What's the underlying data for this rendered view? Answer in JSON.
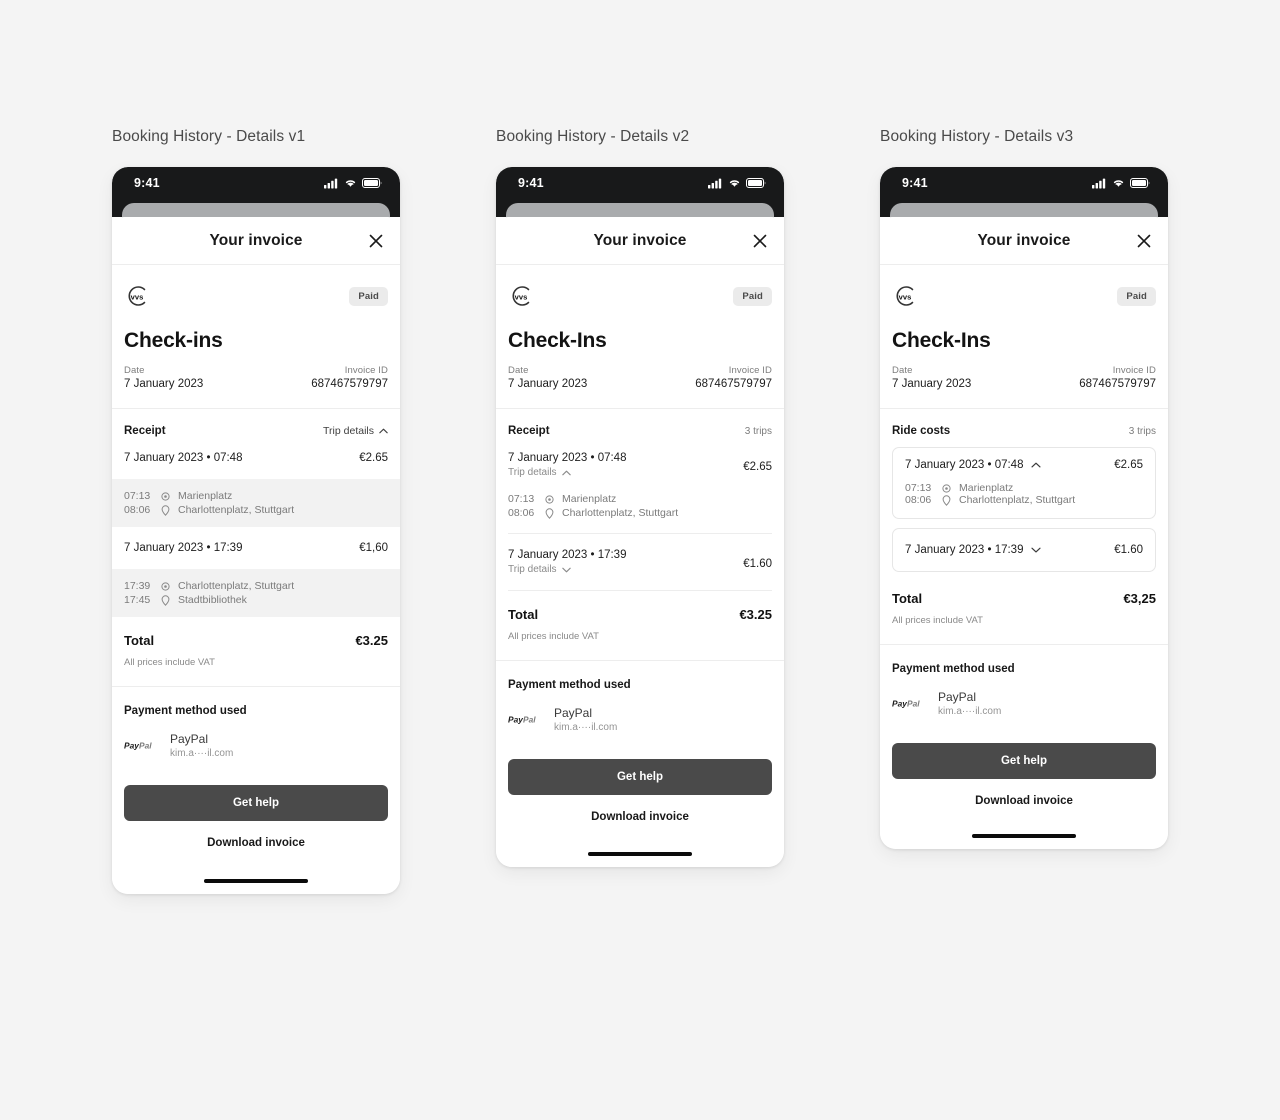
{
  "background": "#f4f4f4",
  "accent_button": "#4a4a4a",
  "screens": [
    {
      "caption": "Booking History - Details v1",
      "status": {
        "time": "9:41"
      },
      "header": {
        "title": "Your invoice",
        "close_icon": "close-icon"
      },
      "brand": {
        "logo_text": "vvs",
        "badge": "Paid"
      },
      "invoice": {
        "title": "Check-ins",
        "date_label": "Date",
        "date_value": "7 January 2023",
        "invoice_id_label": "Invoice ID",
        "invoice_id_value": "687467579797"
      },
      "receipt": {
        "heading": "Receipt",
        "right_label": "Trip details",
        "right_icon": "chevron-up-icon",
        "trips": [
          {
            "date": "7 January 2023 • 07:48",
            "amount": "€2.65",
            "legs": [
              {
                "time": "07:13",
                "icon": "circle-dot-icon",
                "place": "Marienplatz"
              },
              {
                "time": "08:06",
                "icon": "map-pin-icon",
                "place": "Charlottenplatz, Stuttgart"
              }
            ]
          },
          {
            "date": "7 January 2023 • 17:39",
            "amount": "€1,60",
            "legs": [
              {
                "time": "17:39",
                "icon": "circle-dot-icon",
                "place": "Charlottenplatz, Stuttgart"
              },
              {
                "time": "17:45",
                "icon": "map-pin-icon",
                "place": "Stadtbibliothek"
              }
            ]
          }
        ],
        "total_label": "Total",
        "total_value": "€3.25",
        "vat_note": "All prices include VAT"
      },
      "payment": {
        "heading": "Payment method used",
        "provider_logo": "paypal-logo",
        "provider": "PayPal",
        "account": "kim.a····il.com"
      },
      "actions": {
        "primary": "Get help",
        "secondary": "Download invoice"
      }
    },
    {
      "caption": "Booking History - Details v2",
      "status": {
        "time": "9:41"
      },
      "header": {
        "title": "Your invoice",
        "close_icon": "close-icon"
      },
      "brand": {
        "logo_text": "vvs",
        "badge": "Paid"
      },
      "invoice": {
        "title": "Check-Ins",
        "date_label": "Date",
        "date_value": "7 January 2023",
        "invoice_id_label": "Invoice ID",
        "invoice_id_value": "687467579797"
      },
      "receipt": {
        "heading": "Receipt",
        "right_label": "3 trips",
        "trips": [
          {
            "date": "7 January 2023 • 07:48",
            "sub_label": "Trip details",
            "sub_icon": "chevron-up-icon",
            "expanded": true,
            "amount": "€2.65",
            "legs": [
              {
                "time": "07:13",
                "icon": "circle-dot-icon",
                "place": "Marienplatz"
              },
              {
                "time": "08:06",
                "icon": "map-pin-icon",
                "place": "Charlottenplatz, Stuttgart"
              }
            ]
          },
          {
            "date": "7 January 2023 • 17:39",
            "sub_label": "Trip details",
            "sub_icon": "chevron-down-icon",
            "expanded": false,
            "amount": "€1.60",
            "legs": []
          }
        ],
        "total_label": "Total",
        "total_value": "€3.25",
        "vat_note": "All prices include VAT"
      },
      "payment": {
        "heading": "Payment method used",
        "provider_logo": "paypal-logo",
        "provider": "PayPal",
        "account": "kim.a····il.com"
      },
      "actions": {
        "primary": "Get help",
        "secondary": "Download invoice"
      }
    },
    {
      "caption": "Booking History - Details v3",
      "status": {
        "time": "9:41"
      },
      "header": {
        "title": "Your invoice",
        "close_icon": "close-icon"
      },
      "brand": {
        "logo_text": "vvs",
        "badge": "Paid"
      },
      "invoice": {
        "title": "Check-Ins",
        "date_label": "Date",
        "date_value": "7 January 2023",
        "invoice_id_label": "Invoice ID",
        "invoice_id_value": "687467579797"
      },
      "receipt": {
        "heading": "Ride costs",
        "right_label": "3 trips",
        "trips": [
          {
            "date": "7 January 2023 • 07:48",
            "toggle_icon": "chevron-up-icon",
            "expanded": true,
            "amount": "€2.65",
            "legs": [
              {
                "time": "07:13",
                "icon": "circle-dot-icon",
                "place": "Marienplatz"
              },
              {
                "time": "08:06",
                "icon": "map-pin-icon",
                "place": "Charlottenplatz, Stuttgart"
              }
            ]
          },
          {
            "date": "7 January 2023 • 17:39",
            "toggle_icon": "chevron-down-icon",
            "expanded": false,
            "amount": "€1.60",
            "legs": []
          }
        ],
        "total_label": "Total",
        "total_value": "€3,25",
        "vat_note": "All prices include VAT"
      },
      "payment": {
        "heading": "Payment method used",
        "provider_logo": "paypal-logo",
        "provider": "PayPal",
        "account": "kim.a····il.com"
      },
      "actions": {
        "primary": "Get help",
        "secondary": "Download invoice"
      }
    }
  ]
}
